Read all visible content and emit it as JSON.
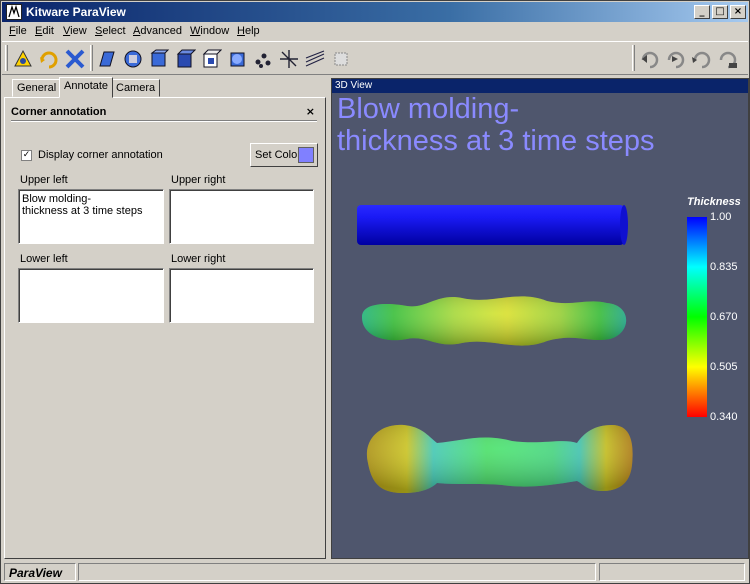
{
  "window": {
    "title": "Kitware ParaView"
  },
  "menu": [
    "File",
    "Edit",
    "View",
    "Select",
    "Advanced",
    "Window",
    "Help"
  ],
  "toolbar": {
    "left_icons": [
      "reset-camera-icon",
      "rotate-icon",
      "interact-icon",
      "extract-icon",
      "slice-icon",
      "clip-icon",
      "glyph-icon",
      "contour-icon",
      "threshold-icon",
      "particles-icon",
      "stream-icon",
      "probe-icon",
      "warp-icon"
    ],
    "right_icons": [
      "first-frame-icon",
      "previous-frame-icon",
      "play-icon",
      "last-frame-icon"
    ]
  },
  "tabs": [
    "General",
    "Annotate",
    "Camera"
  ],
  "annotate": {
    "section_title": "Corner annotation",
    "display_checkbox_label": "Display corner annotation",
    "display_checked": true,
    "set_color_label": "Set Color",
    "swatch_color": "#8080ff",
    "upper_left_label": "Upper left",
    "upper_left_value": "Blow molding-\nthickness at 3 time steps",
    "upper_right_label": "Upper right",
    "upper_right_value": "",
    "lower_left_label": "Lower left",
    "lower_left_value": "",
    "lower_right_label": "Lower right",
    "lower_right_value": ""
  },
  "view": {
    "header": "3D View",
    "corner_text": "Blow molding-\nthickness at 3 time steps",
    "background": "#4f566d",
    "legend": {
      "title": "Thickness",
      "ticks": [
        "1.00",
        "0.835",
        "0.670",
        "0.505",
        "0.340"
      ]
    }
  },
  "status": {
    "label": "ParaView"
  }
}
